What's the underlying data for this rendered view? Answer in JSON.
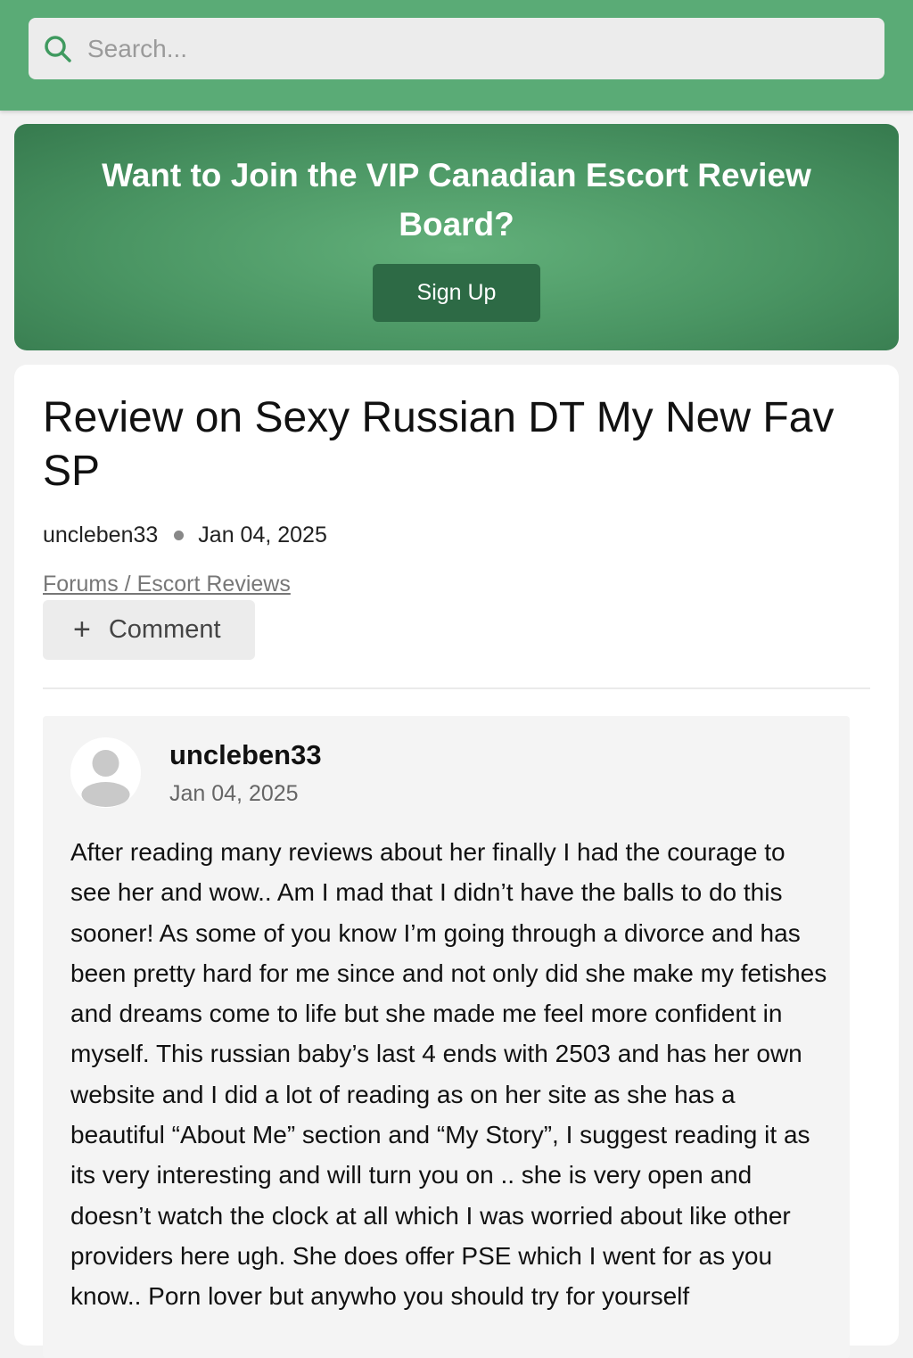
{
  "search": {
    "placeholder": "Search..."
  },
  "promo": {
    "heading": "Want to Join the VIP Canadian Escort Review Board?",
    "button_label": "Sign Up"
  },
  "post": {
    "title": "Review on Sexy Russian DT My New Fav SP",
    "author": "uncleben33",
    "date": "Jan 04, 2025",
    "breadcrumb": "Forums / Escort Reviews",
    "comment_label": "Comment"
  },
  "entry": {
    "author": "uncleben33",
    "date": "Jan 04, 2025",
    "body": "After reading many reviews about her finally I had the courage to see her and wow.. Am I mad that I didn’t have the balls to do this sooner! As some of you know I’m going through a divorce and has been pretty hard for me since and not only did she make my fetishes and dreams come to life but she made me feel more confident in myself. This russian baby’s last 4 ends with 2503 and has her own website and I did a lot of reading as on her site as she has a beautiful “About Me” section and “My Story”, I suggest reading it as its very interesting and will turn you on .. she is very open and doesn’t watch the clock at all which I was worried about like other providers here ugh. She does offer PSE which I went for as you know.. Porn lover but anywho you should try for yourself"
  },
  "icons": {
    "search": "search-icon",
    "plus": "plus-icon",
    "avatar": "user-avatar-icon"
  },
  "colors": {
    "topbar": "#5aab76",
    "promo": "#4a9563",
    "button": "#2d6a45"
  }
}
